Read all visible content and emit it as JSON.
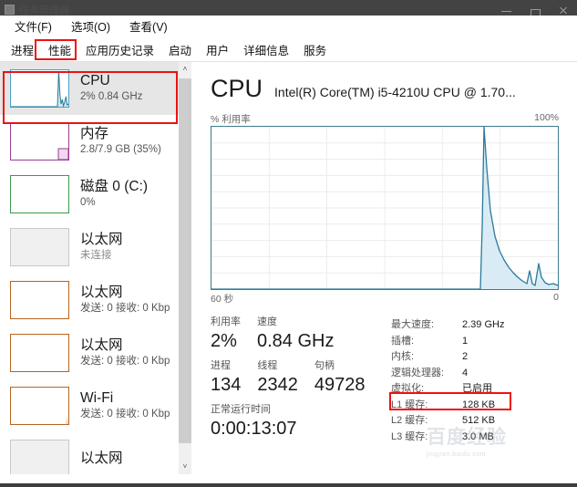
{
  "window": {
    "title": "任务管理器",
    "icon": "taskmanager-icon",
    "minimize_label": "最小化",
    "maximize_label": "最大化",
    "close_label": "关闭"
  },
  "menubar": [
    {
      "label": "文件(F)"
    },
    {
      "label": "选项(O)"
    },
    {
      "label": "查看(V)"
    }
  ],
  "tabs": [
    {
      "label": "进程",
      "selected": false
    },
    {
      "label": "性能",
      "selected": true
    },
    {
      "label": "应用历史记录",
      "selected": false
    },
    {
      "label": "启动",
      "selected": false
    },
    {
      "label": "用户",
      "selected": false
    },
    {
      "label": "详细信息",
      "selected": false
    },
    {
      "label": "服务",
      "selected": false
    }
  ],
  "sidebar": {
    "items": [
      {
        "title": "CPU",
        "sub": "2% 0.84 GHz",
        "color": "#4aa3c7",
        "selected": true,
        "dim": false
      },
      {
        "title": "内存",
        "sub": "2.8/7.9 GB (35%)",
        "color": "#9b3d8f",
        "selected": false,
        "dim": false
      },
      {
        "title": "磁盘 0 (C:)",
        "sub": "0%",
        "color": "#3a9b4a",
        "selected": false,
        "dim": false
      },
      {
        "title": "以太网",
        "sub": "未连接",
        "color": "#c0c0c0",
        "selected": false,
        "dim": true
      },
      {
        "title": "以太网",
        "sub": "发送: 0 接收: 0 Kbp",
        "color": "#b5651d",
        "selected": false,
        "dim": false
      },
      {
        "title": "以太网",
        "sub": "发送: 0 接收: 0 Kbp",
        "color": "#b5651d",
        "selected": false,
        "dim": false
      },
      {
        "title": "Wi-Fi",
        "sub": "发送: 0 接收: 0 Kbp",
        "color": "#b5651d",
        "selected": false,
        "dim": false
      },
      {
        "title": "以太网",
        "sub": "",
        "color": "#c0c0c0",
        "selected": false,
        "dim": true
      }
    ],
    "scrollbar": {
      "up_arrow": "˄",
      "down_arrow": "˅"
    }
  },
  "main": {
    "heading": "CPU",
    "model": "Intel(R) Core(TM) i5-4210U CPU @ 1.70...",
    "graph_label_left": "% 利用率",
    "graph_label_right": "100%",
    "axis_left": "60 秒",
    "axis_right": "0",
    "stats_left": [
      [
        {
          "label": "利用率",
          "value": "2%"
        },
        {
          "label": "速度",
          "value": "0.84 GHz"
        }
      ],
      [
        {
          "label": "进程",
          "value": "134"
        },
        {
          "label": "线程",
          "value": "2342"
        },
        {
          "label": "句柄",
          "value": "49728"
        }
      ],
      [
        {
          "label": "正常运行时间",
          "value": "0:00:13:07"
        }
      ]
    ],
    "stats_right": [
      {
        "key": "最大速度:",
        "value": "2.39 GHz",
        "highlight": false
      },
      {
        "key": "插槽:",
        "value": "1",
        "highlight": false
      },
      {
        "key": "内核:",
        "value": "2",
        "highlight": false
      },
      {
        "key": "逻辑处理器:",
        "value": "4",
        "highlight": false
      },
      {
        "key": "虚拟化:",
        "value": "已启用",
        "highlight": true
      },
      {
        "key": "L1 缓存:",
        "value": "128 KB",
        "highlight": false
      },
      {
        "key": "L2 缓存:",
        "value": "512 KB",
        "highlight": false
      },
      {
        "key": "L3 缓存:",
        "value": "3.0 MB",
        "highlight": false
      }
    ]
  },
  "watermark": {
    "line1": "百度经验",
    "line2": "jingyan.baidu.com"
  },
  "chart_data": {
    "type": "area",
    "title": "% 利用率",
    "xlabel": "60 秒",
    "ylabel": "% 利用率",
    "xlim": [
      60,
      0
    ],
    "ylim": [
      0,
      100
    ],
    "grid": true,
    "grid_rows": 10,
    "grid_cols": 6,
    "line_color": "#2a7a9b",
    "fill_color": "#cfe6f0",
    "series": [
      {
        "name": "CPU 利用率",
        "x": [
          60,
          13.8,
          13.4,
          13.0,
          12.4,
          11.8,
          11.2,
          10.4,
          9.6,
          8.8,
          8.0,
          7.2,
          6.4,
          5.6,
          4.8,
          4.0,
          3.4,
          2.8,
          2.2,
          1.6,
          1.0,
          0.4,
          0
        ],
        "values": [
          0,
          0,
          38,
          100,
          72,
          48,
          33,
          24,
          18,
          14,
          11,
          9,
          7,
          5,
          4,
          3,
          9,
          3,
          2,
          16,
          7,
          3,
          2
        ]
      }
    ],
    "annotations": [
      {
        "text": "100%",
        "position": "top-right"
      },
      {
        "text": "0",
        "position": "bottom-right"
      }
    ]
  },
  "annotations": [
    {
      "name": "tab-performance-highlight",
      "target": "性能"
    },
    {
      "name": "sidebar-cpu-highlight",
      "target": "CPU"
    },
    {
      "name": "virtualization-highlight",
      "target": "虚拟化: 已启用"
    }
  ]
}
